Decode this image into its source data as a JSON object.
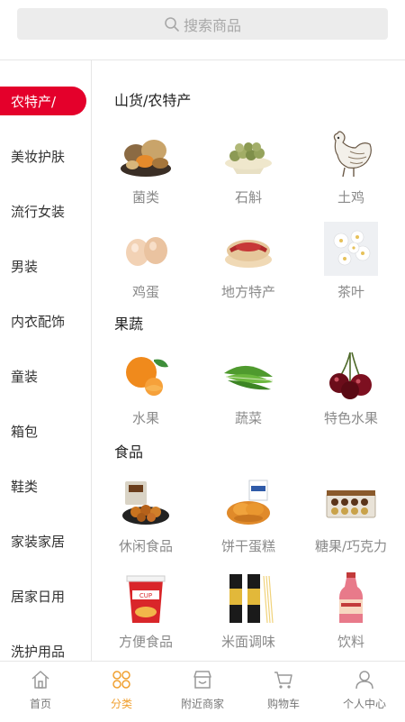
{
  "search": {
    "placeholder": "搜索商品",
    "icon": "search-icon"
  },
  "sidebar": {
    "active_color": "#e4002b",
    "items": [
      {
        "label": "农特产/"
      },
      {
        "label": "美妆护肤"
      },
      {
        "label": "流行女装"
      },
      {
        "label": "男装"
      },
      {
        "label": "内衣配饰"
      },
      {
        "label": "童装"
      },
      {
        "label": "箱包"
      },
      {
        "label": "鞋类"
      },
      {
        "label": "家装家居"
      },
      {
        "label": "居家日用"
      },
      {
        "label": "洗护用品"
      }
    ]
  },
  "content": {
    "sections": [
      {
        "title": "山货/农特产",
        "items": [
          {
            "label": "菌类",
            "icon": "mushroom-icon"
          },
          {
            "label": "石斛",
            "icon": "dendrobium-icon"
          },
          {
            "label": "土鸡",
            "icon": "chicken-icon"
          },
          {
            "label": "鸡蛋",
            "icon": "eggs-icon"
          },
          {
            "label": "地方特产",
            "icon": "pastry-icon"
          },
          {
            "label": "茶叶",
            "icon": "tea-flower-icon"
          }
        ]
      },
      {
        "title": "果蔬",
        "items": [
          {
            "label": "水果",
            "icon": "orange-icon"
          },
          {
            "label": "蔬菜",
            "icon": "vegetable-icon"
          },
          {
            "label": "特色水果",
            "icon": "cherry-icon"
          }
        ]
      },
      {
        "title": "食品",
        "items": [
          {
            "label": "休闲食品",
            "icon": "snack-icon"
          },
          {
            "label": "饼干蛋糕",
            "icon": "bread-icon"
          },
          {
            "label": "糖果/巧克力",
            "icon": "chocolate-box-icon"
          },
          {
            "label": "方便食品",
            "icon": "cup-noodle-icon"
          },
          {
            "label": "米面调味",
            "icon": "noodle-pack-icon"
          },
          {
            "label": "饮料",
            "icon": "drink-bottle-icon"
          }
        ]
      }
    ]
  },
  "tabbar": {
    "active_color": "#f0a030",
    "tabs": [
      {
        "label": "首页",
        "icon": "home-icon"
      },
      {
        "label": "分类",
        "icon": "category-icon"
      },
      {
        "label": "附近商家",
        "icon": "shop-icon"
      },
      {
        "label": "购物车",
        "icon": "cart-icon"
      },
      {
        "label": "个人中心",
        "icon": "user-icon"
      }
    ]
  }
}
